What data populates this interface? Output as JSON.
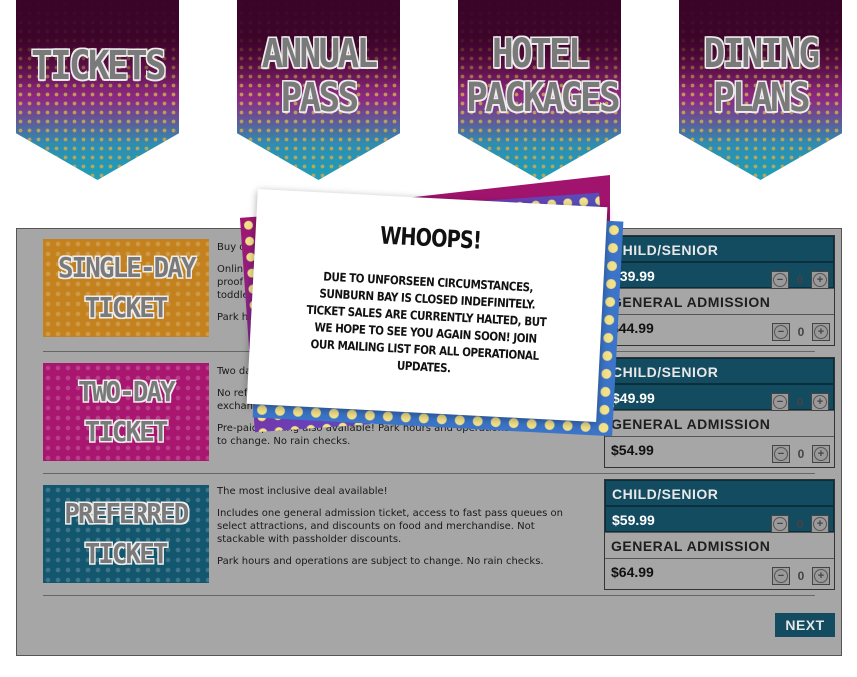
{
  "nav": {
    "tickets": "TICKETS",
    "annual_pass_1": "ANNUAL",
    "annual_pass_2": "PASS",
    "hotel_1": "HOTEL",
    "hotel_2": "PACKAGES",
    "dining_1": "DINING",
    "dining_2": "PLANS"
  },
  "tickets": [
    {
      "name_1": "SINGLE-DAY",
      "name_2": "TICKET",
      "desc_1": "Buy o",
      "desc_2": "Online",
      "desc_3": "proof o",
      "desc_4": "toddle",
      "desc_5": "Park ho",
      "child_label": "CHILD/SENIOR",
      "child_price": "$39.99",
      "adult_label": "GENERAL ADMISSION",
      "adult_price": "$44.99",
      "child_qty": "0",
      "adult_qty": "0"
    },
    {
      "name_1": "TWO-DAY",
      "name_2": "TICKET",
      "desc_1": "Two da",
      "desc_2": "No refu",
      "desc_3": "exchang",
      "desc_4": "Pre-paid parking also available! Park hours and operations are subject to change. No rain checks.",
      "child_label": "CHILD/SENIOR",
      "child_price": "$49.99",
      "adult_label": "GENERAL ADMISSION",
      "adult_price": "$54.99",
      "child_qty": "0",
      "adult_qty": "0"
    },
    {
      "name_1": "PREFERRED",
      "name_2": "TICKET",
      "desc_1": "The most inclusive deal available!",
      "desc_2": "Includes one general admission ticket, access to fast pass queues on select attractions, and discounts on food and merchandise. Not stackable with passholder discounts.",
      "desc_3": "Park hours and operations are subject to change. No rain checks.",
      "child_label": "CHILD/SENIOR",
      "child_price": "$59.99",
      "adult_label": "GENERAL ADMISSION",
      "adult_price": "$64.99",
      "child_qty": "0",
      "adult_qty": "0"
    }
  ],
  "controls": {
    "minus": "−",
    "plus": "+",
    "next": "NEXT"
  },
  "modal": {
    "title": "WHOOPS!",
    "message": "DUE TO UNFORSEEN CIRCUMSTANCES, SUNBURN BAY IS CLOSED INDEFINITELY. TICKET SALES ARE CURRENTLY HALTED, BUT WE HOPE TO SEE YOU AGAIN SOON! JOIN OUR MAILING LIST FOR ALL OPERATIONAL UPDATES."
  },
  "colors": {
    "panel_bg": "#a6a6a6",
    "accent_blue": "#134b60",
    "orange": "#c4821f",
    "magenta": "#a8166f"
  }
}
